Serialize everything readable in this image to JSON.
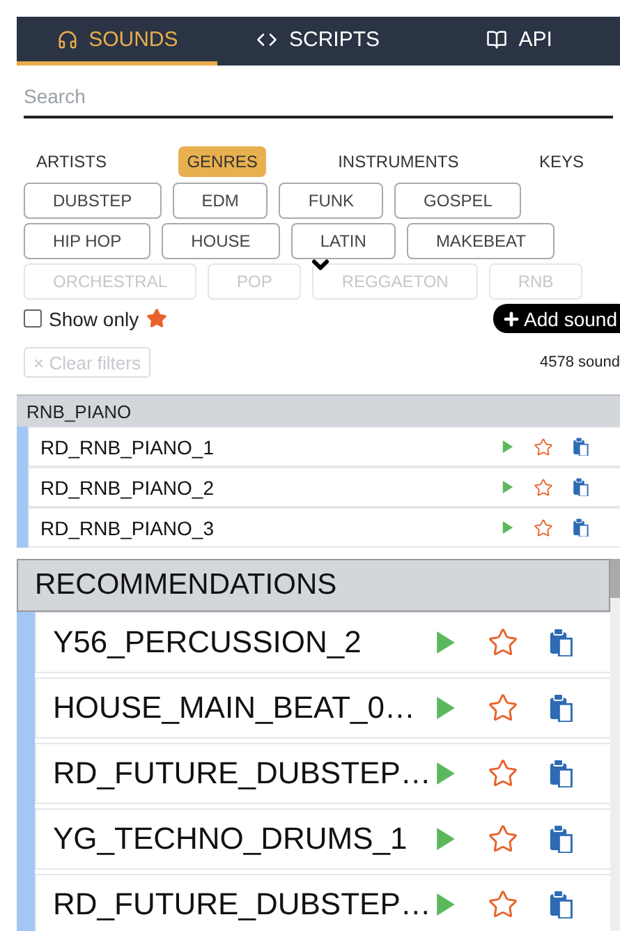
{
  "nav_tabs": [
    {
      "label": "SOUNDS",
      "selected": true
    },
    {
      "label": "SCRIPTS",
      "selected": false
    },
    {
      "label": "API",
      "selected": false
    }
  ],
  "search": {
    "placeholder": "Search"
  },
  "filter_tabs": [
    {
      "label": "ARTISTS",
      "selected": false
    },
    {
      "label": "GENRES",
      "selected": true
    },
    {
      "label": "INSTRUMENTS",
      "selected": false
    },
    {
      "label": "KEYS",
      "selected": false
    }
  ],
  "genres": [
    [
      {
        "label": "DUBSTEP",
        "faded": false
      },
      {
        "label": "EDM",
        "faded": false
      },
      {
        "label": "FUNK",
        "faded": false
      },
      {
        "label": "GOSPEL",
        "faded": false
      }
    ],
    [
      {
        "label": "HIP HOP",
        "faded": false
      },
      {
        "label": "HOUSE",
        "faded": false
      },
      {
        "label": "LATIN",
        "faded": false
      },
      {
        "label": "MAKEBEAT",
        "faded": false
      }
    ],
    [
      {
        "label": "ORCHESTRAL",
        "faded": true
      },
      {
        "label": "POP",
        "faded": true
      },
      {
        "label": "REGGAETON",
        "faded": true
      },
      {
        "label": "RNB",
        "faded": true
      }
    ]
  ],
  "show_only": {
    "label": "Show only",
    "checked": false
  },
  "add_button": {
    "label": "Add sound"
  },
  "clear_filters": {
    "label": "× Clear filters",
    "disabled": true
  },
  "sound_count": "4578 sound",
  "folders": [
    {
      "name": "RNB_PIANO",
      "sounds": [
        {
          "name": "RD_RNB_PIANO_1",
          "favorite": false
        },
        {
          "name": "RD_RNB_PIANO_2",
          "favorite": false
        },
        {
          "name": "RD_RNB_PIANO_3",
          "favorite": false
        }
      ]
    }
  ],
  "recommendations": {
    "title": "RECOMMENDATIONS",
    "sounds": [
      {
        "name": "Y56_PERCUSSION_2",
        "favorite": false
      },
      {
        "name": "HOUSE_MAIN_BEAT_0…",
        "favorite": false
      },
      {
        "name": "RD_FUTURE_DUBSTEP…",
        "favorite": false
      },
      {
        "name": "YG_TECHNO_DRUMS_1",
        "favorite": false
      },
      {
        "name": "RD_FUTURE_DUBSTEP…",
        "favorite": false
      }
    ]
  }
}
